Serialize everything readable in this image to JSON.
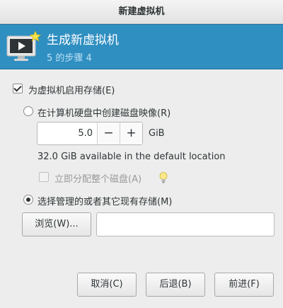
{
  "window": {
    "title": "新建虚拟机"
  },
  "banner": {
    "title": "生成新虚拟机",
    "step": "5 的步骤 4",
    "icon": "monitor-play-icon"
  },
  "storage": {
    "enable_label": "为虚拟机启用存储(E)",
    "enable_checked": true,
    "create_image_label": "在计算机硬盘中创建磁盘映像(R)",
    "create_image_selected": false,
    "size_value": "5.0",
    "size_unit": "GiB",
    "decrement_symbol": "−",
    "increment_symbol": "+",
    "available_text": "32.0 GiB available in the default location",
    "allocate_label": "立即分配整个磁盘(A)",
    "allocate_checked": false,
    "allocate_hint_icon": "lightbulb-icon",
    "existing_label": "选择管理的或者其它现有存储(M)",
    "existing_selected": true,
    "browse_label": "浏览(W)...",
    "path_value": ""
  },
  "footer": {
    "cancel_label": "取消(C)",
    "back_label": "后退(B)",
    "forward_label": "前进(F)"
  }
}
